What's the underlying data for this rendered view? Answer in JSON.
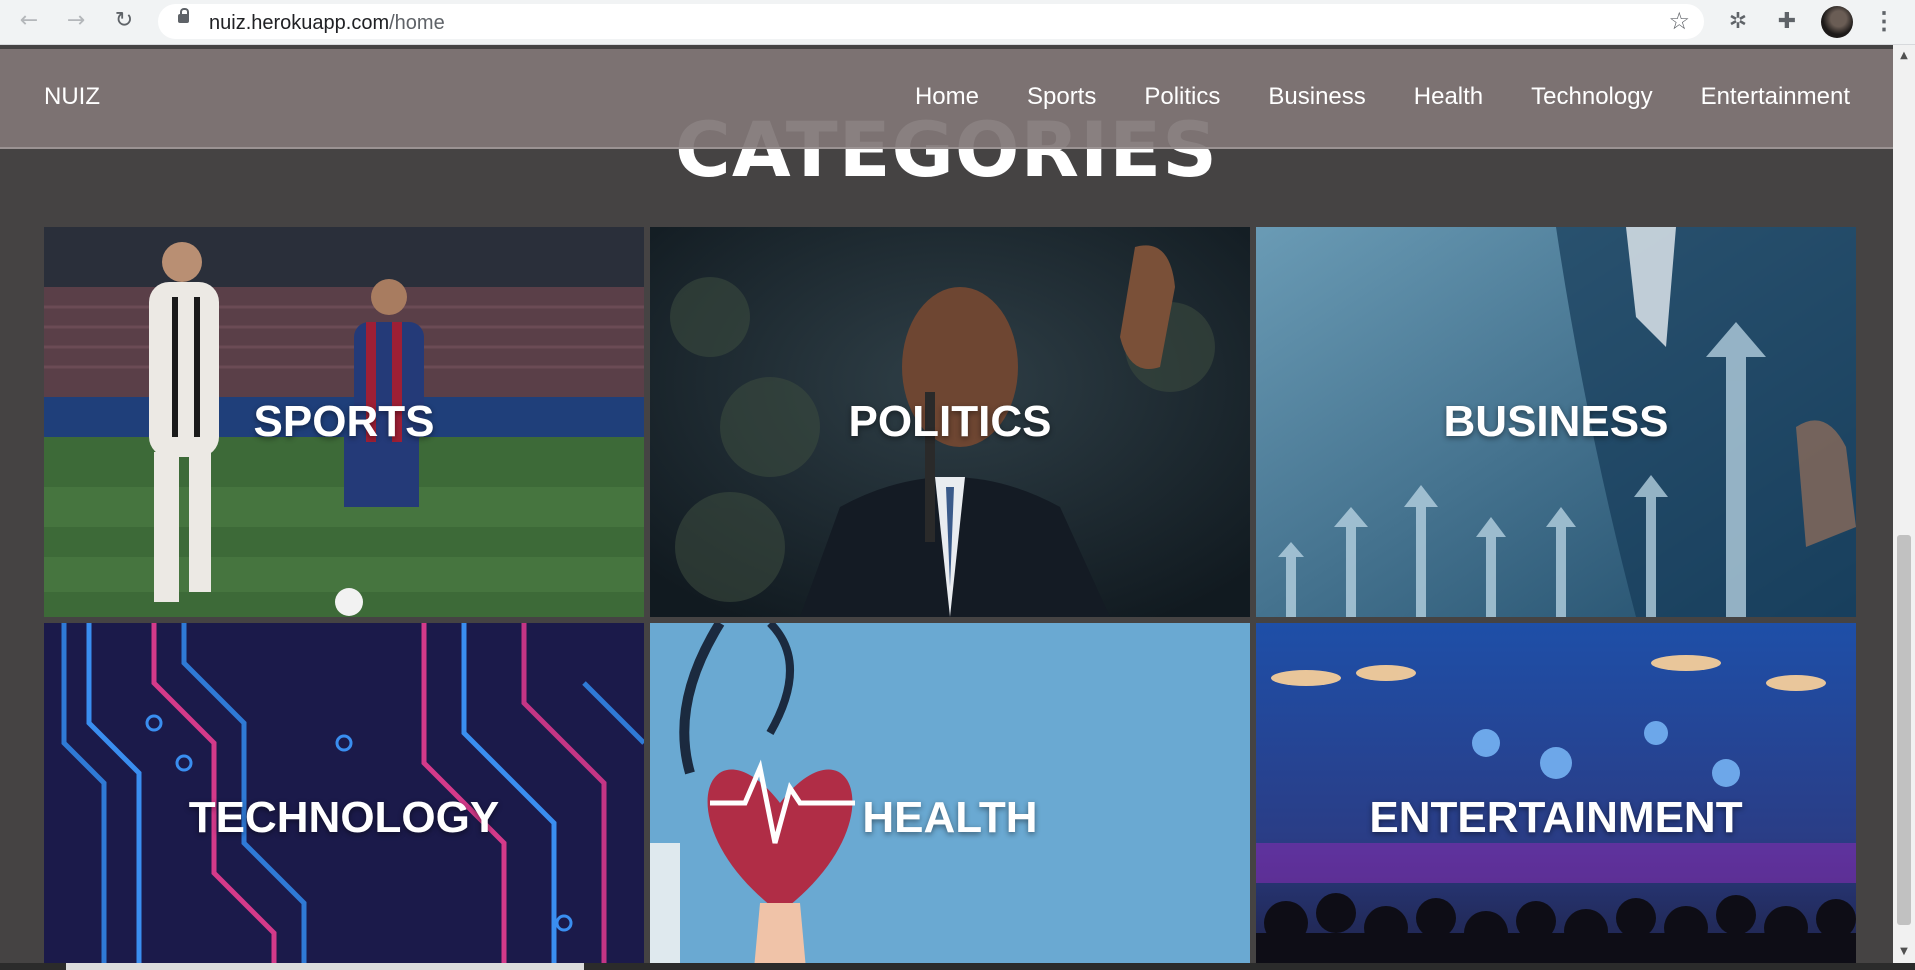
{
  "browser": {
    "url_host": "nuiz.herokuapp.com",
    "url_path": "/home",
    "back_icon": "arrow-left",
    "forward_icon": "arrow-right",
    "reload_icon": "reload",
    "bookmark_icon": "star",
    "extension_icons": [
      "bug",
      "puzzle-piece"
    ],
    "menu_icon": "vertical-dots"
  },
  "site": {
    "brand": "NUIZ",
    "nav": [
      "Home",
      "Sports",
      "Politics",
      "Business",
      "Health",
      "Technology",
      "Entertainment"
    ],
    "section_title": "CATEGORIES",
    "categories": [
      {
        "label": "SPORTS"
      },
      {
        "label": "POLITICS"
      },
      {
        "label": "BUSINESS"
      },
      {
        "label": "TECHNOLOGY"
      },
      {
        "label": "HEALTH"
      },
      {
        "label": "ENTERTAINMENT"
      }
    ]
  },
  "colors": {
    "navbar_bg": "#807676",
    "page_bg": "#454343",
    "text": "#ffffff"
  }
}
